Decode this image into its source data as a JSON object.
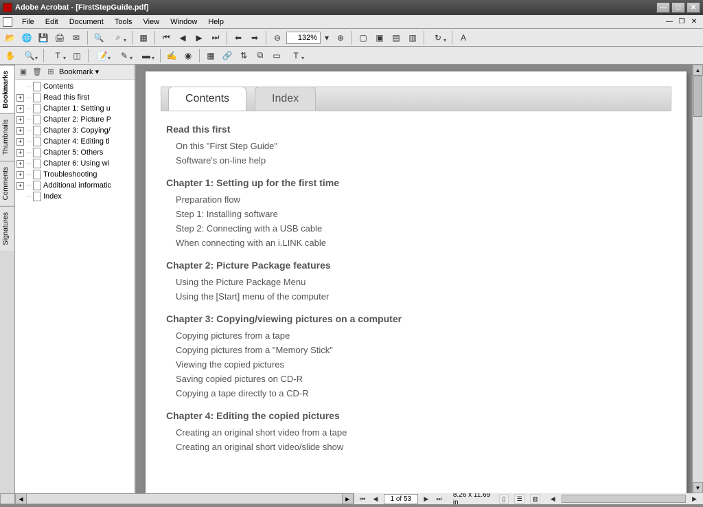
{
  "titlebar": {
    "title": "Adobe Acrobat - [FirstStepGuide.pdf]"
  },
  "menu": {
    "items": [
      "File",
      "Edit",
      "Document",
      "Tools",
      "View",
      "Window",
      "Help"
    ]
  },
  "toolbar1": {
    "zoom_value": "132%"
  },
  "side_tabs": [
    "Bookmarks",
    "Thumbnails",
    "Comments",
    "Signatures"
  ],
  "bookmarks": {
    "menu_label": "Bookmark",
    "items": [
      {
        "expandable": false,
        "text": "Contents"
      },
      {
        "expandable": true,
        "text": "Read this first"
      },
      {
        "expandable": true,
        "text": "Chapter 1: Setting u"
      },
      {
        "expandable": true,
        "text": "Chapter 2: Picture P"
      },
      {
        "expandable": true,
        "text": "Chapter 3: Copying/"
      },
      {
        "expandable": true,
        "text": "Chapter 4: Editing tl"
      },
      {
        "expandable": true,
        "text": "Chapter 5: Others"
      },
      {
        "expandable": true,
        "text": "Chapter 6: Using wi"
      },
      {
        "expandable": true,
        "text": "Troubleshooting"
      },
      {
        "expandable": true,
        "text": "Additional informatic"
      },
      {
        "expandable": false,
        "text": "Index"
      }
    ]
  },
  "pdf": {
    "tabs": {
      "active": "Contents",
      "inactive": "Index"
    },
    "sections": [
      {
        "title": "Read this first",
        "entries": [
          "On this \"First Step Guide\"",
          "Software's on-line help"
        ]
      },
      {
        "title": "Chapter 1: Setting up for the first time",
        "entries": [
          "Preparation flow",
          "Step 1: Installing software",
          "Step 2: Connecting with a USB cable",
          "When connecting with an i.LINK cable"
        ]
      },
      {
        "title": "Chapter 2: Picture Package features",
        "entries": [
          "Using the Picture Package Menu",
          "Using the [Start] menu of the computer"
        ]
      },
      {
        "title": "Chapter 3: Copying/viewing pictures on a computer",
        "entries": [
          "Copying pictures from a tape",
          "Copying pictures from a \"Memory Stick\"",
          "Viewing the copied pictures",
          "Saving copied pictures on CD-R",
          "Copying a tape directly to a CD-R"
        ]
      },
      {
        "title": "Chapter 4: Editing the copied pictures",
        "entries": [
          "Creating an original short video from a tape",
          "Creating an original short video/slide show"
        ]
      }
    ]
  },
  "statusbar": {
    "page_indicator": "1 of 53",
    "dimensions": "8.26 x 11.69 in"
  }
}
